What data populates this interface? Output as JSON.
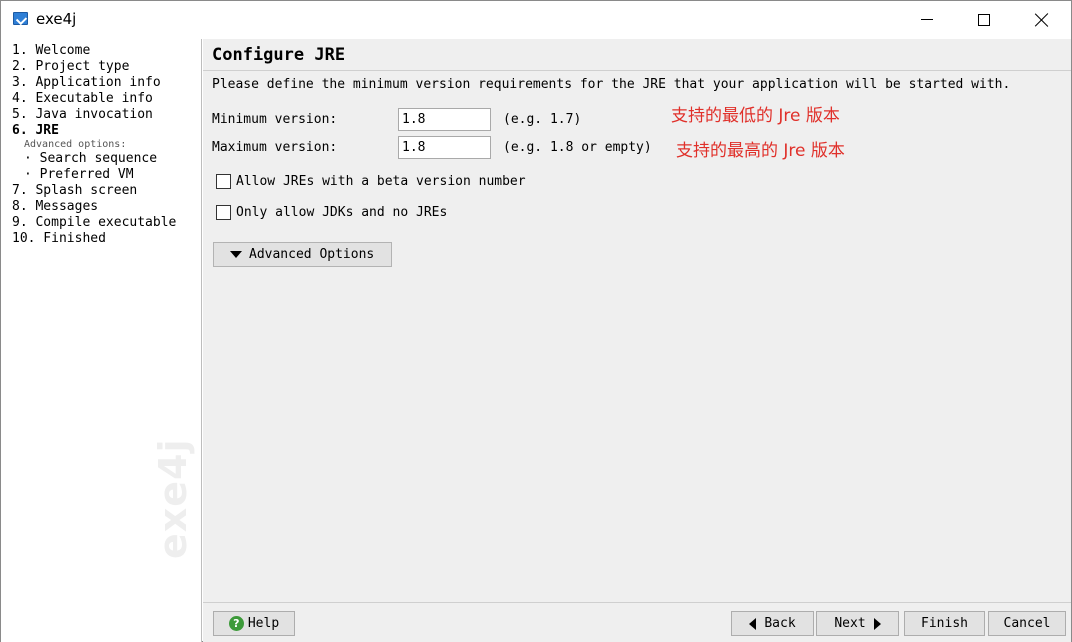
{
  "window": {
    "title": "exe4j"
  },
  "sidebar": {
    "items": [
      {
        "label": "1. Welcome"
      },
      {
        "label": "2. Project type"
      },
      {
        "label": "3. Application info"
      },
      {
        "label": "4. Executable info"
      },
      {
        "label": "5. Java invocation"
      },
      {
        "label": "6. JRE"
      }
    ],
    "advanced_title": "Advanced options:",
    "sub_items": [
      {
        "label": "· Search sequence"
      },
      {
        "label": "· Preferred VM"
      }
    ],
    "items_after": [
      {
        "label": "7. Splash screen"
      },
      {
        "label": "8. Messages"
      },
      {
        "label": "9. Compile executable"
      },
      {
        "label": "10. Finished"
      }
    ],
    "watermark": "exe4j"
  },
  "main": {
    "title": "Configure JRE",
    "description": "Please define the minimum version requirements for the JRE that your application will be started with.",
    "min_label": "Minimum version:",
    "min_value": "1.8",
    "min_hint": "(e.g. 1.7)",
    "max_label": "Maximum version:",
    "max_value": "1.8",
    "max_hint": "(e.g. 1.8 or empty)",
    "annotation_min": "支持的最低的 Jre 版本",
    "annotation_max": "支持的最高的 Jre 版本",
    "check_beta": "Allow JREs with a beta version number",
    "check_jdk": "Only allow JDKs and no JREs",
    "advanced_button": "Advanced Options"
  },
  "footer": {
    "help": "Help",
    "back": "Back",
    "next": "Next",
    "finish": "Finish",
    "cancel": "Cancel"
  },
  "colors": {
    "annotation": "#e0302a",
    "help_icon": "#3d9a3a"
  }
}
